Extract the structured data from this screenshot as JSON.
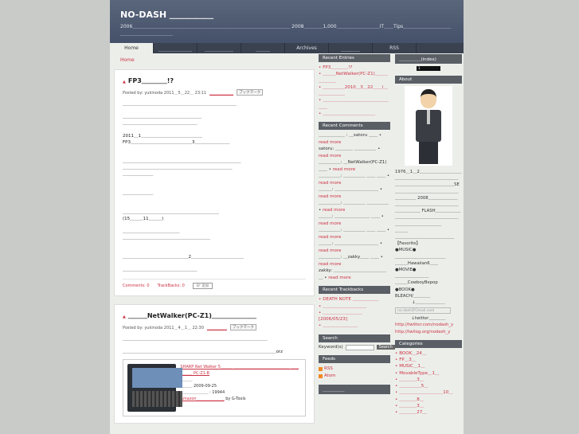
{
  "site": {
    "title": "NO-DASH ＿＿＿＿＿",
    "desc": "2006＿＿＿＿＿＿＿＿＿＿＿＿＿＿＿＿＿＿＿＿＿＿＿＿＿＿＿＿＿＿＿＿＿ 2008＿＿＿＿1,000＿＿＿＿＿＿＿＿＿IT＿＿Tips＿＿＿＿＿＿＿＿＿＿＿＿＿＿＿＿＿＿＿＿＿"
  },
  "nav": [
    "Home",
    "＿＿＿＿＿＿＿",
    "＿＿＿＿＿＿",
    "＿＿＿",
    "Archives",
    "＿＿＿＿",
    "RSS"
  ],
  "breadcrumb": "Home",
  "posts": [
    {
      "title": "FP3＿＿＿＿!?",
      "meta": "Posted by: yukinoda  2011＿5＿22＿ 23:11",
      "category": "＿＿＿＿＿＿",
      "bookmark": "ブックマーク",
      "lines": [
        "＿＿＿＿＿＿＿＿＿＿＿＿＿＿＿＿＿＿＿＿＿＿＿＿＿＿",
        "",
        "＿＿＿＿＿＿＿＿＿＿＿＿＿＿＿＿＿＿",
        "＿＿＿＿＿＿＿＿＿＿＿＿＿＿＿＿＿",
        "",
        "2011＿1＿＿＿＿＿＿＿＿＿＿＿＿＿＿",
        "FP3＿＿＿＿＿＿＿＿＿＿＿＿＿＿3＿＿＿＿＿＿＿＿",
        "",
        "",
        "＿＿＿＿＿＿＿＿＿＿＿＿＿＿＿＿＿＿＿＿＿＿＿＿＿＿＿",
        "＿＿＿＿＿＿＿＿＿＿＿＿＿＿＿＿＿＿＿＿＿＿＿＿＿",
        "＿＿＿＿＿＿＿",
        "",
        "",
        "＿＿＿＿＿＿＿",
        "",
        "",
        "＿＿＿＿＿＿＿＿＿＿＿＿＿＿＿＿＿＿＿＿＿＿",
        "(15＿＿＿11＿＿＿)",
        "",
        "＿＿＿＿＿＿＿＿＿＿＿＿＿",
        "＿＿＿＿＿＿＿＿＿＿＿＿＿＿＿＿＿＿＿＿",
        "",
        "",
        "＿＿＿＿＿＿＿＿＿＿＿＿＿＿＿2＿＿＿＿＿＿＿＿＿＿＿＿",
        "",
        "＿＿＿＿＿＿＿＿＿＿＿＿＿＿＿＿＿"
      ],
      "comments": "Comments: 0",
      "trackbacks": "TrackBacks: 0",
      "hatena": "B! 追加"
    },
    {
      "title": "＿＿＿NetWalker(PC-Z1)＿＿＿＿＿＿＿",
      "meta": "Posted by: yukinoda  2011＿4＿1＿ 22:30",
      "category": "＿＿＿＿＿",
      "bookmark": "ブックマーク",
      "lines": [
        "＿＿＿＿＿＿＿＿＿＿＿＿＿＿＿＿＿＿＿＿＿＿＿＿＿＿＿＿＿＿＿＿＿",
        "",
        "＿＿＿＿＿＿＿＿＿＿＿＿＿＿＿＿＿＿＿＿＿＿＿＿＿＿＿＿＿＿＿＿＿＿＿orz"
      ],
      "product": {
        "title": "SHARP Net Walker 5＿＿＿ ＿＿＿＿＿＿＿＿＿＿＿＿＿＿ ＿＿＿＿＿ PC-Z1-B",
        "maker": "＿＿＿",
        "date": "＿＿＿ 2009-09-25",
        "price": "＿＿＿＿＿＿＿ : 19944",
        "amazon": "Amazon＿＿＿＿＿＿＿",
        "by": "by G-Tools"
      }
    }
  ],
  "recent_entries": {
    "title": "Recent Entries",
    "items": [
      "FP3＿＿＿＿!?",
      "＿＿＿NetWalker(PC-Z1)＿＿＿＿＿＿＿",
      "＿＿＿＿＿2010＿3＿22＿＿)＿＿＿＿＿＿＿",
      "＿＿＿＿＿＿＿＿＿＿＿＿＿＿＿＿＿",
      "＿＿＿＿＿＿＿＿＿＿＿＿"
    ]
  },
  "recent_comments": {
    "title": "Recent Comments",
    "items": [
      {
        "who": "＿＿＿＿＿＿ : ＿satoru ＿＿",
        "more": "read more"
      },
      {
        "who": "satoru: ＿＿＿＿ ＿＿＿＿＿",
        "more": "read more"
      },
      {
        "who": "＿＿＿＿＿: ＿NetWalker(PC-Z1)＿＿",
        "more": "read more"
      },
      {
        "who": "＿＿＿＿＿: ＿＿＿＿＿ ＿＿ ＿＿",
        "more": "read more"
      },
      {
        "who": "＿＿＿: ＿＿＿＿＿＿＿＿＿＿",
        "more": "read more"
      },
      {
        "who": "＿＿＿＿＿: ＿＿＿＿＿ ＿＿＿＿＿",
        "more": "read more"
      },
      {
        "who": "＿＿＿: ＿＿＿＿＿＿＿＿ ＿＿",
        "more": "read more"
      },
      {
        "who": "＿＿＿＿＿: ＿＿＿＿＿ ＿＿ ＿＿",
        "more": "read more"
      },
      {
        "who": "＿＿＿: ＿＿＿＿＿＿＿＿＿＿",
        "more": "read more"
      },
      {
        "who": "＿＿＿＿＿: ＿zakky＿＿ ＿＿",
        "more": "read more"
      },
      {
        "who": "zakky: ＿＿＿＿＿＿＿＿＿＿＿＿＿",
        "more": "read more"
      }
    ]
  },
  "recent_trackbacks": {
    "title": "Recent Trackbacks",
    "items": [
      "DEATH NOTE ＿＿＿＿＿＿",
      "＿＿＿＿＿＿＿＿＿＿",
      "＿＿＿＿＿＿＿＿＿ [2006/05/23]",
      "＿＿＿＿＿＿＿＿"
    ]
  },
  "search": {
    "title": "Search",
    "label": "Keyword(s)",
    "button": "Search"
  },
  "feeds": {
    "title": "Feeds",
    "items": [
      "RSS",
      "Atom"
    ]
  },
  "extra": {
    "title": "＿＿＿＿＿"
  },
  "index": {
    "title": "＿＿＿＿＿(index)",
    "counter": "1"
  },
  "about": {
    "title": "About",
    "text": "1976＿1＿2＿＿＿＿＿＿＿＿＿＿＿＿＿＿＿＿＿＿＿＿＿＿＿＿＿＿＿＿＿＿＿＿＿＿＿＿＿＿＿SE＿＿＿＿＿＿＿＿＿＿＿＿＿＿＿＿＿＿＿＿ 2008＿＿＿＿＿＿＿＿＿＿＿＿＿＿＿＿＿＿＿＿＿＿＿＿＿＿＿＿ FLASH＿＿＿＿＿＿＿＿＿＿＿＿＿＿＿＿＿＿＿＿＿＿＿＿＿＿＿＿＿＿＿＿",
    "fav_lines": [
      "＿＿＿",
      "＿＿＿＿＿＿＿＿＿＿＿＿＿＿",
      "【Favorite】",
      "●MUSIC●",
      "＿＿＿＿＿＿＿＿＿＿＿＿",
      "＿＿＿Hawaiian6＿＿",
      "●MOVIE●",
      "＿＿＿＿＿＿＿＿",
      "＿＿＿CowboyBepop",
      "●BOOK●",
      "BLEACH/＿＿＿＿"
    ],
    "mail_label": "↓＿＿＿＿＿＿＿",
    "mail_value": "no.dash＠Gmail.com",
    "twitter_label": "↓twitter＿＿＿＿",
    "links": [
      "http://twitter.com/nodash_y",
      "http://twilog.org/nodash_y"
    ]
  },
  "categories": {
    "title": "Categories",
    "items": [
      "BOOK＿24＿",
      "FP＿3＿",
      "MUSIC＿1＿",
      "MovableType＿1＿",
      "＿＿＿＿3＿",
      "＿＿＿＿＿5＿",
      "＿＿＿＿＿＿＿＿＿＿10＿",
      "＿＿＿＿8＿",
      "＿＿＿＿3＿",
      "＿＿＿＿27＿"
    ]
  }
}
